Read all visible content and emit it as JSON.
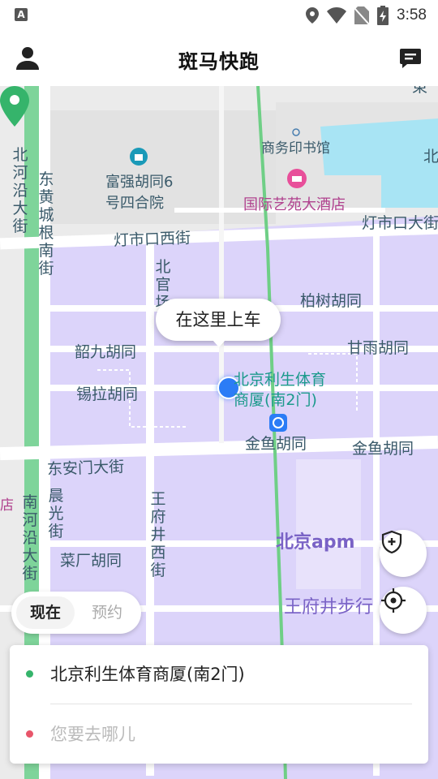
{
  "status_bar": {
    "left_icon": "A",
    "time": "3:58",
    "icons": [
      "location-icon",
      "wifi-icon",
      "no-sim-icon",
      "battery-charging-icon"
    ]
  },
  "header": {
    "title": "斑马快跑",
    "left_icon": "user-icon",
    "right_icon": "message-icon"
  },
  "map": {
    "pickup_bubble": "在这里上车",
    "pickup_location_label": "北京利生体育商厦(南2门)",
    "street_labels": {
      "beiheyan": "北河沿大街",
      "donghuangcheng": "东黄城根南街",
      "dengshikou_xi": "灯市口西街",
      "dengshikou_da": "灯市口大街",
      "beiyou": "北官场",
      "baishu": "柏树胡同",
      "shaojiu": "韶九胡同",
      "ganyu": "甘雨胡同",
      "xila": "锡拉胡同",
      "jinyu_1": "金鱼胡同",
      "jinyu_2": "金鱼胡同",
      "dongan": "东安门大街",
      "nanheyan": "南河沿大街",
      "chenguang": "晨光街",
      "wangfujing_xi": "王府井西街",
      "caichang": "菜厂胡同",
      "wangfujing_walk": "王府井步行",
      "fuqiang": "富强胡同6号四合院",
      "north_edge": "北",
      "top_right": "東"
    },
    "pois": {
      "shangwu": "商务印书馆",
      "guoji": "国际艺苑大酒店",
      "apm": "北京apm",
      "left_edge": "店"
    },
    "colors": {
      "purple_area": "#dcd4fa",
      "green_road": "#7ed49a",
      "water": "#a8e4f4",
      "pin": "#35b46b",
      "loc_dot": "#2b7cf6"
    }
  },
  "mode_tabs": {
    "now": "现在",
    "book": "预约"
  },
  "address_card": {
    "from": "北京利生体育商厦(南2门)",
    "to_placeholder": "您要去哪儿",
    "from_dot_color": "#35b46b",
    "to_dot_color": "#e8556a"
  },
  "map_buttons": {
    "safety": "shield-plus-icon",
    "locate": "locate-icon"
  }
}
